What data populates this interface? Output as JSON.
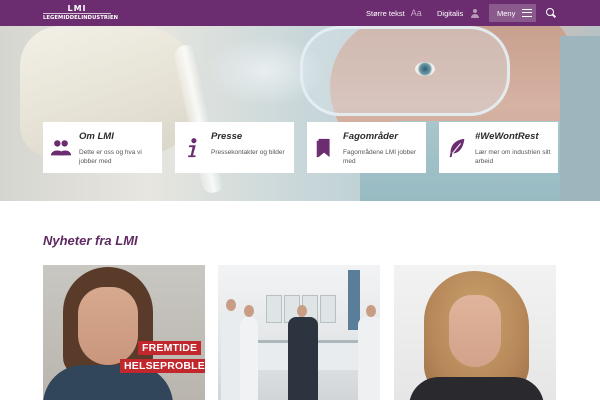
{
  "header": {
    "logo_top": "LMI",
    "logo_bottom": "LEGEMIDDELINDUSTRIEN",
    "text_size_label": "Større tekst",
    "text_size_icon": "Aa",
    "digitalis_label": "Digitalis",
    "menu_label": "Meny"
  },
  "cards": [
    {
      "icon": "people-icon",
      "title": "Om LMI",
      "description": "Dette er oss og hva vi jobber med"
    },
    {
      "icon": "info-icon",
      "title": "Presse",
      "description": "Pressekontakter og bilder"
    },
    {
      "icon": "bookmark-icon",
      "title": "Fagområder",
      "description": "Fagområdene LMI jobber med"
    },
    {
      "icon": "feather-icon",
      "title": "#WeWontRest",
      "description": "Lær mer om industrien sitt arbeid"
    }
  ],
  "news": {
    "heading": "Nyheter fra LMI",
    "items": [
      {
        "banner_line1": "FREMTIDE",
        "banner_line2": "HELSEPROBLEM"
      },
      {
        "banner_line1": "",
        "banner_line2": ""
      },
      {
        "banner_line1": "",
        "banner_line2": ""
      }
    ]
  },
  "colors": {
    "brand_purple": "#6b2d6f",
    "menu_button": "#8a5a8d",
    "news_heading": "#5e2a62",
    "banner_red": "#c1272d"
  }
}
